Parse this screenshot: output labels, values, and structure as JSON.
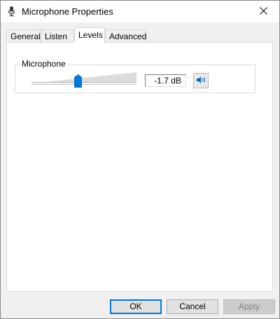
{
  "window": {
    "title": "Microphone Properties",
    "title_icon": "microphone-device-icon",
    "close_icon": "close-icon"
  },
  "tabs": [
    {
      "label": "General",
      "active": false
    },
    {
      "label": "Listen",
      "active": false
    },
    {
      "label": "Levels",
      "active": true
    },
    {
      "label": "Advanced",
      "active": false
    }
  ],
  "levels": {
    "group_label": "Microphone",
    "slider_level_percent": 44,
    "value_text": "-1.7 dB",
    "mute_icon": "speaker-icon"
  },
  "buttons": {
    "ok": "OK",
    "cancel": "Cancel",
    "apply": "Apply"
  },
  "colors": {
    "accent": "#0078d7",
    "window_bg": "#f0f0f0",
    "panel_bg": "#ffffff"
  }
}
